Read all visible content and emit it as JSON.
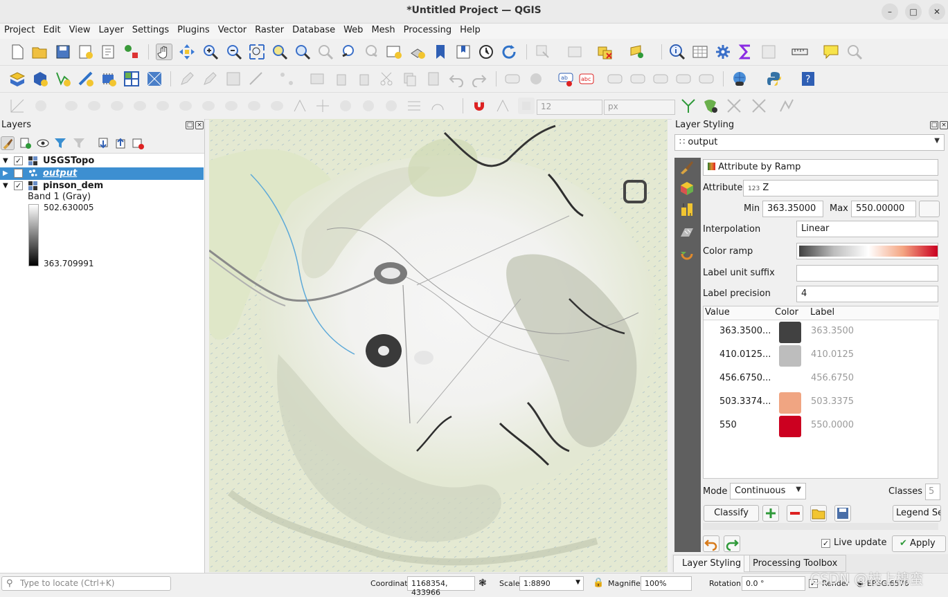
{
  "window": {
    "title": "*Untitled Project — QGIS"
  },
  "menu": [
    "Project",
    "Edit",
    "View",
    "Layer",
    "Settings",
    "Plugins",
    "Vector",
    "Raster",
    "Database",
    "Web",
    "Mesh",
    "Processing",
    "Help"
  ],
  "toolbar": {
    "snap_value": "12",
    "snap_unit": "px"
  },
  "layers_panel": {
    "title": "Layers",
    "layers": [
      {
        "name": "USGSTopo",
        "checked": true
      },
      {
        "name": "output",
        "checked": false,
        "selected": true
      },
      {
        "name": "pinson_dem",
        "checked": true
      }
    ],
    "band_label": "Band 1 (Gray)",
    "max_value": "502.630005",
    "min_value": "363.709991"
  },
  "styling_panel": {
    "title": "Layer Styling",
    "layer_selector": "output",
    "renderer": "Attribute by Ramp",
    "attribute_label": "Attribute",
    "attribute_value": "Z",
    "attribute_type": "123",
    "min_label": "Min",
    "min_value": "363.35000",
    "max_label": "Max",
    "max_value": "550.00000",
    "interpolation_label": "Interpolation",
    "interpolation_value": "Linear",
    "color_ramp_label": "Color ramp",
    "label_unit_suffix_label": "Label unit suffix",
    "label_precision_label": "Label precision",
    "label_precision_value": "4",
    "table_headers": {
      "value": "Value",
      "color": "Color",
      "label": "Label"
    },
    "classes": [
      {
        "value": "363.3500...",
        "color": "#414141",
        "label": "363.3500"
      },
      {
        "value": "410.0125...",
        "color": "#bdbdbd",
        "label": "410.0125"
      },
      {
        "value": "456.6750...",
        "color": "#ffffff",
        "label": "456.6750"
      },
      {
        "value": "503.3374...",
        "color": "#f0a582",
        "label": "503.3375"
      },
      {
        "value": "550",
        "color": "#cc0020",
        "label": "550.0000"
      }
    ],
    "mode_label": "Mode",
    "mode_value": "Continuous",
    "classes_label": "Classes",
    "classes_value": "5",
    "classify_button": "Classify",
    "legend_button": "Legend Se",
    "live_update_label": "Live update",
    "apply_button": "Apply"
  },
  "bottom_tabs": [
    "Layer Styling",
    "Processing Toolbox"
  ],
  "statusbar": {
    "locate_placeholder": "Type to locate (Ctrl+K)",
    "coordinate_label": "Coordinate",
    "coordinate_value": "1168354, 433966",
    "scale_label": "Scale",
    "scale_value": "1:8890",
    "magnifier_label": "Magnifier",
    "magnifier_value": "100%",
    "rotation_label": "Rotation",
    "rotation_value": "0.0 °",
    "render_label": "Render",
    "crs_value": "EPSG:6576"
  },
  "watermark": "CSDN @枝上棉蛮",
  "colors": {
    "selection": "#3d8fd1",
    "panel_sidebar": "#5f5f5f"
  }
}
